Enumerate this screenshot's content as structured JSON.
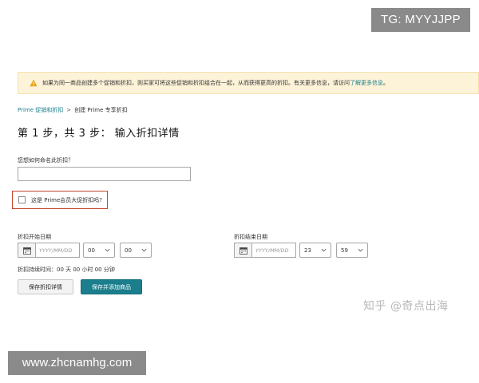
{
  "watermarks": {
    "tg": "TG: MYYJJPP",
    "zhihu": "知乎 @奇点出海",
    "site": "www.zhcnamhg.com"
  },
  "alert": {
    "icon": "warning-icon",
    "text": "如果为同一商品创建多个促销和折扣，则买家可将这些促销和折扣组合在一起，从而获得更高的折扣。有关更多信息，请访问",
    "link": "了解更多信息",
    "tail": "。"
  },
  "breadcrumb": {
    "parent": "Prime 促销和折扣",
    "separator": ">",
    "current": "创建 Prime 专享折扣"
  },
  "page_title": "第 1 步，共 3 步： 输入折扣详情",
  "name_field": {
    "label": "您想如何命名此折扣？",
    "value": ""
  },
  "prime_checkbox": {
    "label": "这是 Prime会员大促折扣吗?",
    "checked": false
  },
  "start": {
    "label": "折扣开始日期",
    "date_placeholder": "YYYY/MM/DD",
    "hour": "00",
    "minute": "00"
  },
  "end": {
    "label": "折扣结束日期",
    "date_placeholder": "YYYY/MM/DD",
    "hour": "23",
    "minute": "59"
  },
  "duration": "折扣持续时间：00 天 00 小时 00 分钟",
  "buttons": {
    "save_details": "保存折扣详情",
    "save_add_products": "保存并添加商品"
  },
  "colors": {
    "accent": "#1a7e8c",
    "alert_bg": "#fdf3d8",
    "highlight_border": "#c0452a"
  }
}
